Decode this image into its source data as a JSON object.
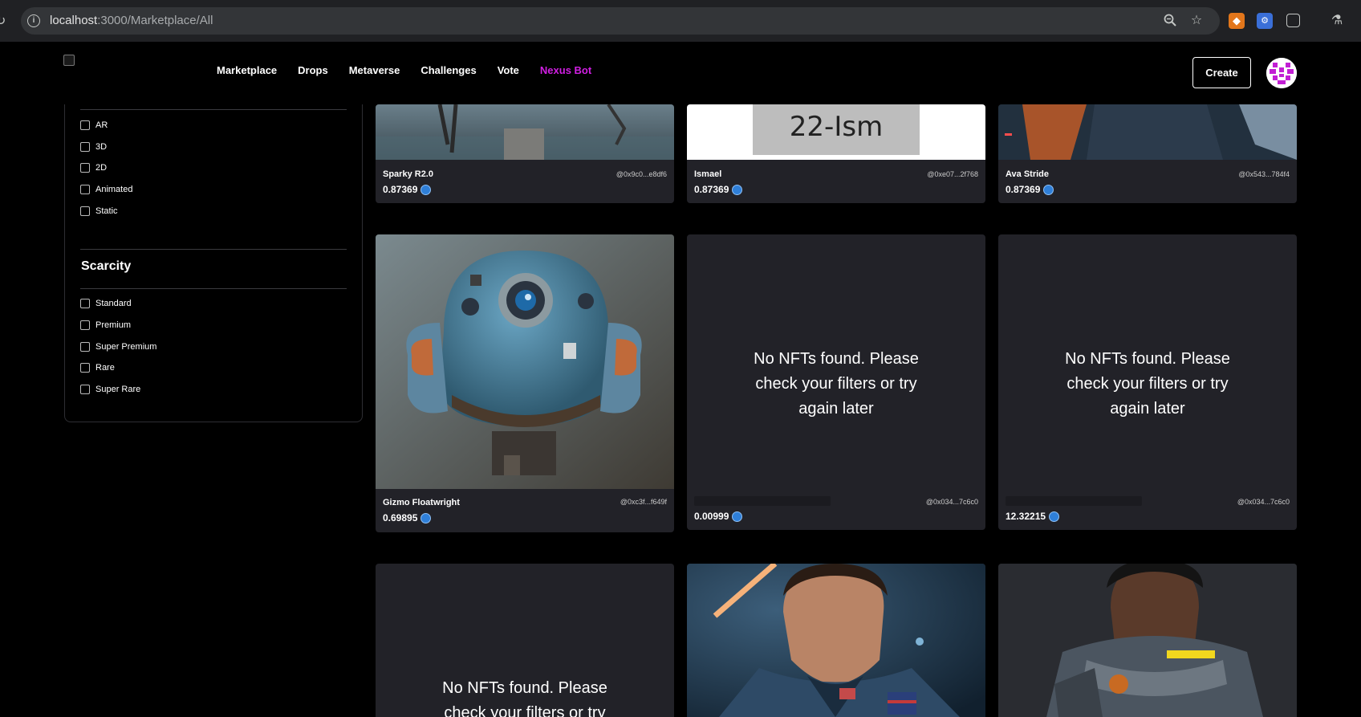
{
  "browser": {
    "url_host": "localhost",
    "url_path": ":3000/Marketplace/All",
    "icons": [
      "reload-icon",
      "site-info-icon",
      "zoom-icon",
      "bookmark-star-icon",
      "metamask-extension-icon",
      "extension-icon",
      "puzzle-extensions-icon",
      "labs-flask-icon"
    ]
  },
  "header": {
    "nav": [
      "Marketplace",
      "Drops",
      "Metaverse",
      "Challenges",
      "Vote",
      "Nexus Bot"
    ],
    "active_nav": "Nexus Bot",
    "active_color": "#d11fe3",
    "create_label": "Create"
  },
  "sidebar": {
    "type_options": [
      "AR",
      "3D",
      "2D",
      "Animated",
      "Static"
    ],
    "scarcity_title": "Scarcity",
    "scarcity_options": [
      "Standard",
      "Premium",
      "Super Premium",
      "Rare",
      "Super Rare"
    ]
  },
  "cards": [
    {
      "name": "Sparky R2.0",
      "owner": "@0x9c0...e8df6",
      "price": "0.87369"
    },
    {
      "name": "Ismael",
      "owner": "@0xe07...2f768",
      "price": "0.87369",
      "image_text": "22-Ism"
    },
    {
      "name": "Ava Stride",
      "owner": "@0x543...784f4",
      "price": "0.87369"
    },
    {
      "name": "Gizmo Floatwright",
      "owner": "@0xc3f...f649f",
      "price": "0.69895"
    },
    {
      "empty_message": "No NFTs found. Please check your filters or try again later",
      "owner": "@0x034...7c6c0",
      "price": "0.00999"
    },
    {
      "empty_message": "No NFTs found. Please check your filters or try again later",
      "owner": "@0x034...7c6c0",
      "price": "12.32215"
    },
    {
      "empty_message": "No NFTs found. Please check your filters or try again later"
    },
    {},
    {}
  ],
  "colors": {
    "card_bg": "#222228",
    "eth_blue": "#2f7fd8",
    "brand_magenta": "#d11fe3"
  }
}
